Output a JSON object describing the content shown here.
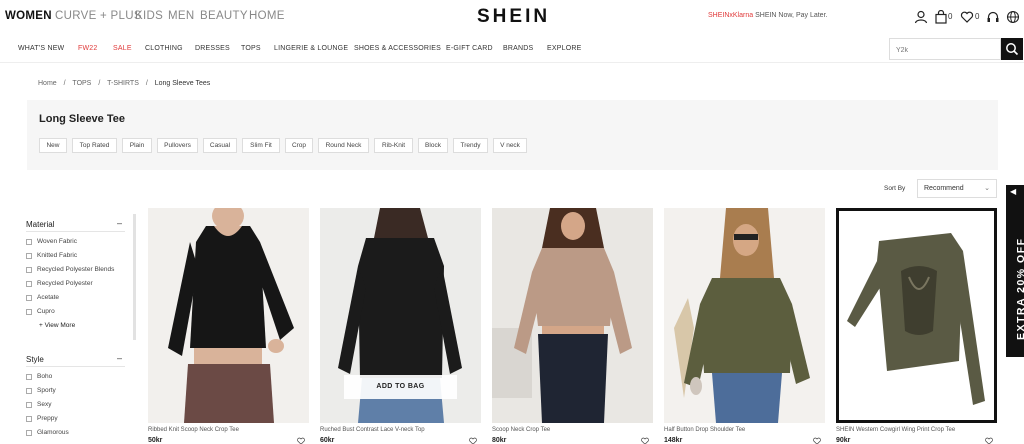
{
  "header": {
    "categories": [
      "WOMEN",
      "CURVE + PLUS",
      "KIDS",
      "MEN",
      "BEAUTY",
      "HOME"
    ],
    "logo": "SHEIN",
    "promo_brand": "SHEINxKlarna",
    "promo_text": "SHEIN Now, Pay Later.",
    "bag_count": "0",
    "wishlist_count": "0"
  },
  "nav": {
    "items": [
      "WHAT'S NEW",
      "FW22",
      "SALE",
      "CLOTHING",
      "DRESSES",
      "TOPS",
      "LINGERIE & LOUNGE",
      "SHOES & ACCESSORIES",
      "E-GIFT CARD",
      "BRANDS",
      "EXPLORE"
    ],
    "search_placeholder": "Y2k"
  },
  "breadcrumb": [
    "Home",
    "/",
    "TOPS",
    "/",
    "T-SHIRTS",
    "/",
    "Long Sleeve Tees"
  ],
  "page": {
    "title": "Long Sleeve Tee",
    "tags": [
      "New",
      "Top Rated",
      "Plain",
      "Pullovers",
      "Casual",
      "Slim Fit",
      "Crop",
      "Round Neck",
      "Rib-Knit",
      "Block",
      "Trendy",
      "V neck"
    ]
  },
  "sort": {
    "label": "Sort By",
    "value": "Recommend"
  },
  "filters": {
    "material_title": "Material",
    "material_options": [
      "Woven Fabric",
      "Knitted Fabric",
      "Recycled Polyester Blends",
      "Recycled Polyester",
      "Acetate",
      "Cupro"
    ],
    "view_more": "+ View More",
    "style_title": "Style",
    "style_options": [
      "Boho",
      "Sporty",
      "Sexy",
      "Preppy",
      "Glamorous"
    ]
  },
  "products": [
    {
      "name": "Ribbed Knit Scoop Neck Crop Tee",
      "price": "50kr"
    },
    {
      "name": "Ruched Bust Contrast Lace V-neck Top",
      "price": "60kr",
      "add_to_bag": "ADD TO BAG"
    },
    {
      "name": "Scoop Neck Crop Tee",
      "price": "80kr"
    },
    {
      "name": "Half Button Drop Shoulder Tee",
      "price": "148kr"
    },
    {
      "name": "SHEIN Western Cowgirl Wing Print Crop Tee",
      "price": "90kr"
    }
  ],
  "side_tab": {
    "text": "EXTRA 20% OFF"
  },
  "colors": {
    "accent_red": "#e03a3a",
    "black": "#111111",
    "panel_bg": "#f6f6f6"
  }
}
